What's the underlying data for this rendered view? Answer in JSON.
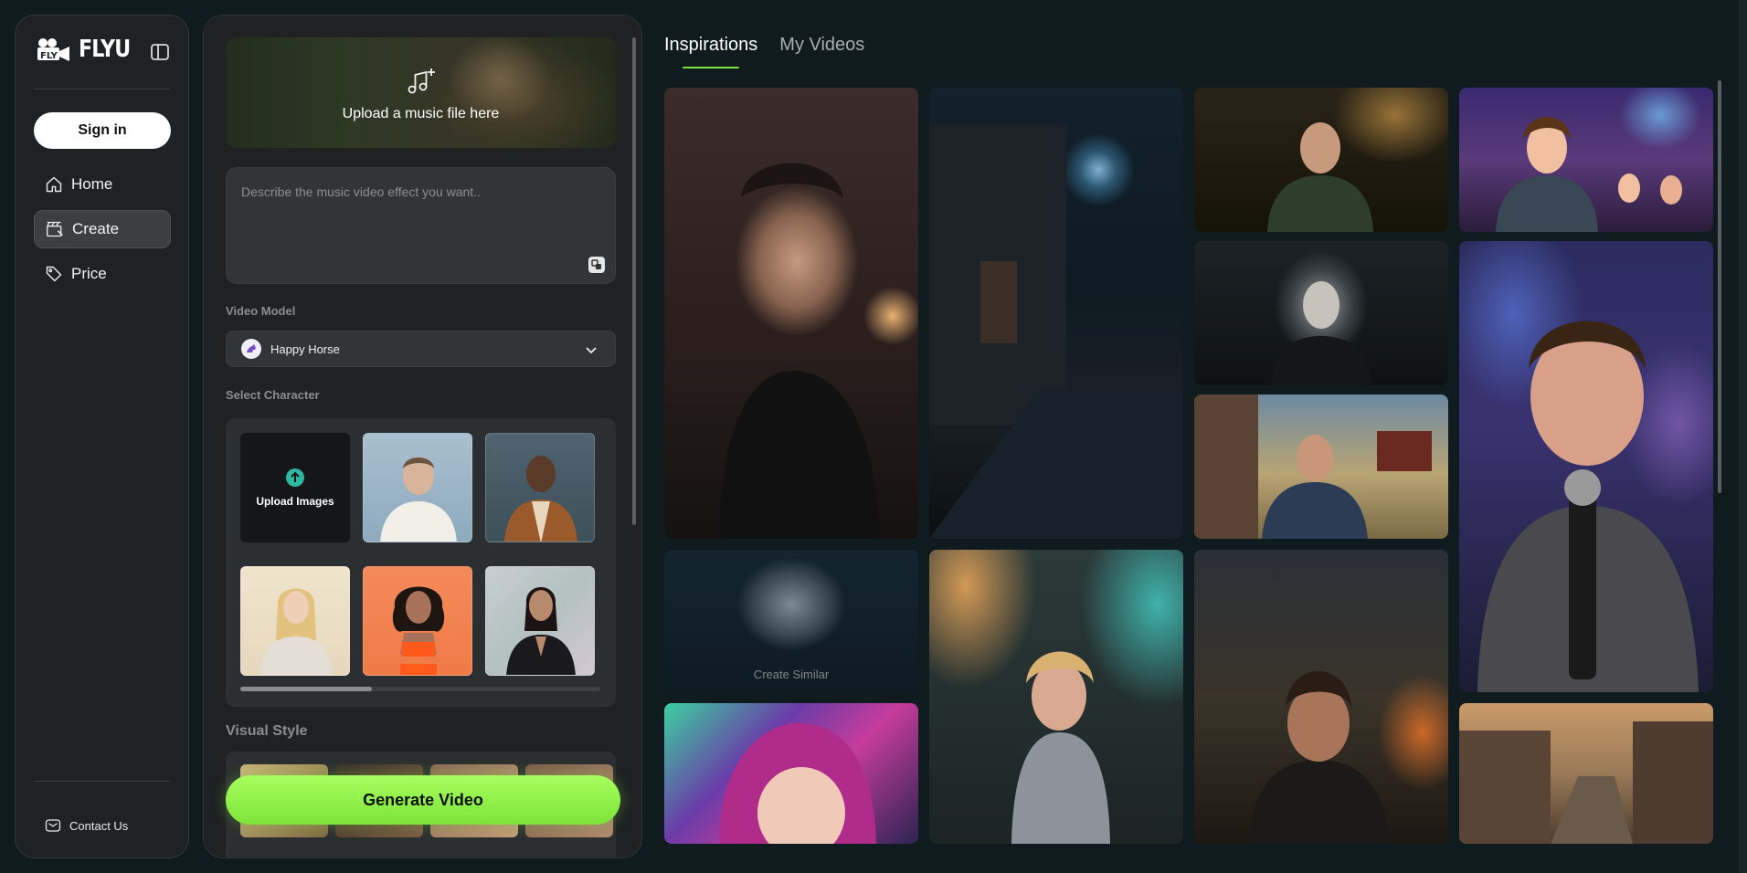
{
  "app": {
    "brand": "FLYU"
  },
  "sidebar": {
    "signin_label": "Sign in",
    "items": [
      {
        "label": "Home",
        "icon": "home-icon",
        "active": false
      },
      {
        "label": "Create",
        "icon": "create-icon",
        "active": true
      },
      {
        "label": "Price",
        "icon": "price-tag-icon",
        "active": false
      }
    ],
    "contact_label": "Contact Us"
  },
  "create": {
    "upload_music_label": "Upload a music file here",
    "prompt_placeholder": "Describe the music video effect you want..",
    "video_model_label": "Video Model",
    "video_model_value": "Happy Horse",
    "select_character_label": "Select Character",
    "upload_images_label": "Upload Images",
    "visual_style_label": "Visual Style",
    "generate_label": "Generate Video"
  },
  "gallery": {
    "tabs": [
      {
        "label": "Inspirations",
        "active": true
      },
      {
        "label": "My Videos",
        "active": false
      }
    ],
    "hover_caption": "Create Similar"
  },
  "colors": {
    "accent": "#7ee33b",
    "background": "#0f1b1f",
    "panel": "#1f2123"
  }
}
